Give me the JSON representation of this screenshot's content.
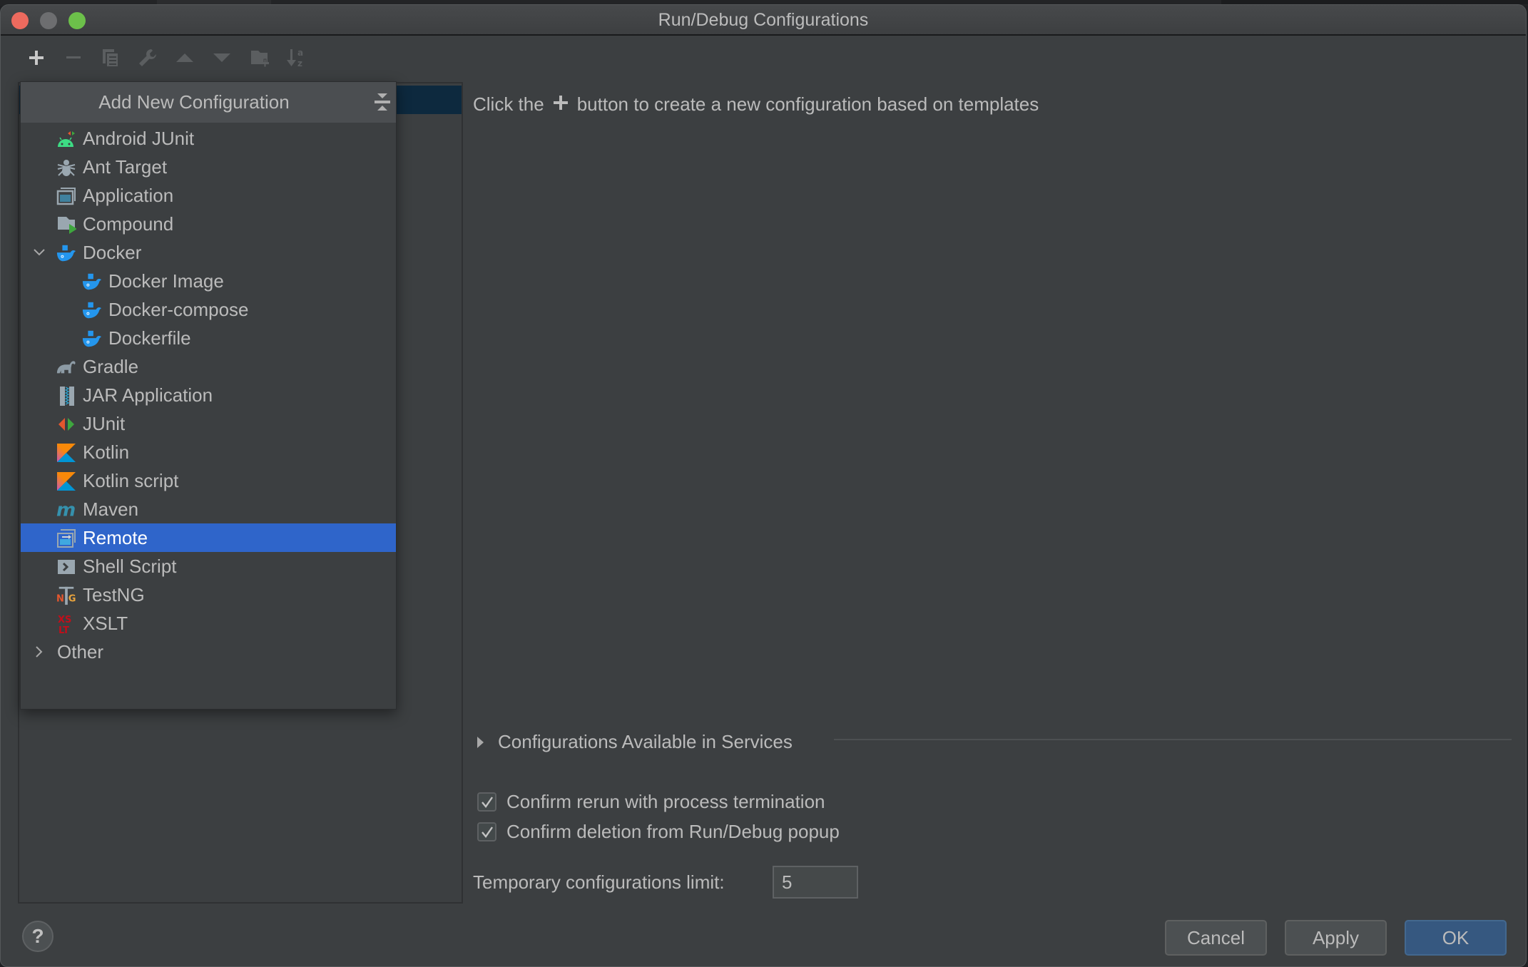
{
  "window": {
    "title": "Run/Debug Configurations",
    "traffic_lights": {
      "close": "#ed6a5e",
      "minimize": "#6d6e70",
      "zoom": "#6cc04a"
    }
  },
  "toolbar": {
    "items": [
      {
        "name": "add",
        "icon": "plus-icon",
        "enabled": true
      },
      {
        "name": "remove",
        "icon": "minus-icon",
        "enabled": false
      },
      {
        "name": "copy",
        "icon": "copy-icon",
        "enabled": false
      },
      {
        "name": "edit-templates",
        "icon": "wrench-icon",
        "enabled": false
      },
      {
        "name": "move-up",
        "icon": "arrow-up-icon",
        "enabled": false
      },
      {
        "name": "move-down",
        "icon": "arrow-down-icon",
        "enabled": false
      },
      {
        "name": "new-folder",
        "icon": "folder-add-icon",
        "enabled": false
      },
      {
        "name": "sort",
        "icon": "sort-alpha-icon",
        "enabled": false
      }
    ]
  },
  "popup": {
    "title": "Add New Configuration",
    "collapse_icon": "collapse-all-icon",
    "items": [
      {
        "label": "Android JUnit",
        "icon": "android-junit-icon",
        "level": 1
      },
      {
        "label": "Ant Target",
        "icon": "ant-icon",
        "level": 1
      },
      {
        "label": "Application",
        "icon": "application-icon",
        "level": 1
      },
      {
        "label": "Compound",
        "icon": "compound-icon",
        "level": 1
      },
      {
        "label": "Docker",
        "icon": "docker-icon",
        "level": 1,
        "expanded": true
      },
      {
        "label": "Docker Image",
        "icon": "docker-icon",
        "level": 2
      },
      {
        "label": "Docker-compose",
        "icon": "docker-icon",
        "level": 2
      },
      {
        "label": "Dockerfile",
        "icon": "docker-icon",
        "level": 2
      },
      {
        "label": "Gradle",
        "icon": "gradle-icon",
        "level": 1
      },
      {
        "label": "JAR Application",
        "icon": "jar-icon",
        "level": 1
      },
      {
        "label": "JUnit",
        "icon": "junit-icon",
        "level": 1
      },
      {
        "label": "Kotlin",
        "icon": "kotlin-icon",
        "level": 1
      },
      {
        "label": "Kotlin script",
        "icon": "kotlin-icon",
        "level": 1
      },
      {
        "label": "Maven",
        "icon": "maven-icon",
        "level": 1
      },
      {
        "label": "Remote",
        "icon": "remote-icon",
        "level": 1,
        "selected": true
      },
      {
        "label": "Shell Script",
        "icon": "shell-script-icon",
        "level": 1
      },
      {
        "label": "TestNG",
        "icon": "testng-icon",
        "level": 1
      },
      {
        "label": "XSLT",
        "icon": "xslt-icon",
        "level": 1
      },
      {
        "label": "Other",
        "icon": null,
        "level": 0,
        "expanded": false
      }
    ]
  },
  "main": {
    "hint_before": "Click the",
    "hint_after": "button to create a new configuration based on templates",
    "services_label": "Configurations Available in Services",
    "checkboxes": [
      {
        "label": "Confirm rerun with process termination",
        "checked": true
      },
      {
        "label": "Confirm deletion from Run/Debug popup",
        "checked": true
      }
    ],
    "temp_limit_label": "Temporary configurations limit:",
    "temp_limit_value": "5"
  },
  "buttons": {
    "help": "?",
    "cancel": "Cancel",
    "apply": "Apply",
    "ok": "OK"
  },
  "colors": {
    "selection": "#2f65ca",
    "ok_button": "#365880",
    "panel_bg": "#3c3f41"
  }
}
